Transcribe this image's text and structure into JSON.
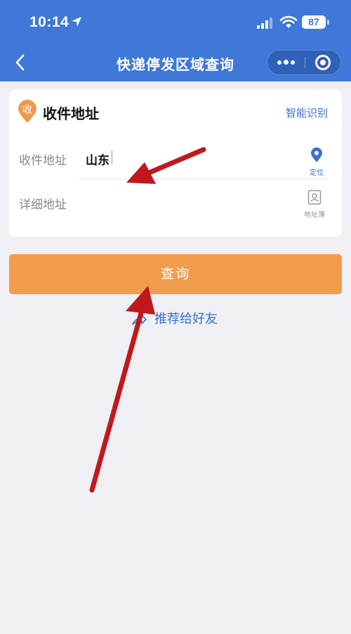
{
  "status_bar": {
    "time": "10:14",
    "battery": "87",
    "location_icon": "location-arrow-icon",
    "signal_icon": "cellular-signal-icon",
    "wifi_icon": "wifi-icon"
  },
  "nav": {
    "title": "快递停发区域查询",
    "back_icon": "chevron-left-icon",
    "more_icon": "more-dots-icon",
    "close_icon": "target-close-icon"
  },
  "card": {
    "badge_char": "收",
    "title": "收件地址",
    "smart_link": "智能识别",
    "address_label": "收件地址",
    "address_value": "山东",
    "locate_caption": "定位",
    "detail_label": "详细地址",
    "address_book_caption": "地址簿"
  },
  "query_button": "查询",
  "share_link": "推荐给好友",
  "colors": {
    "header_blue": "#3f78d8",
    "link_blue": "#3a73c9",
    "button_orange": "#f29d4e",
    "badge_orange": "#ee9a4c",
    "annotation_red": "#c0181c",
    "background": "#efeff4"
  }
}
